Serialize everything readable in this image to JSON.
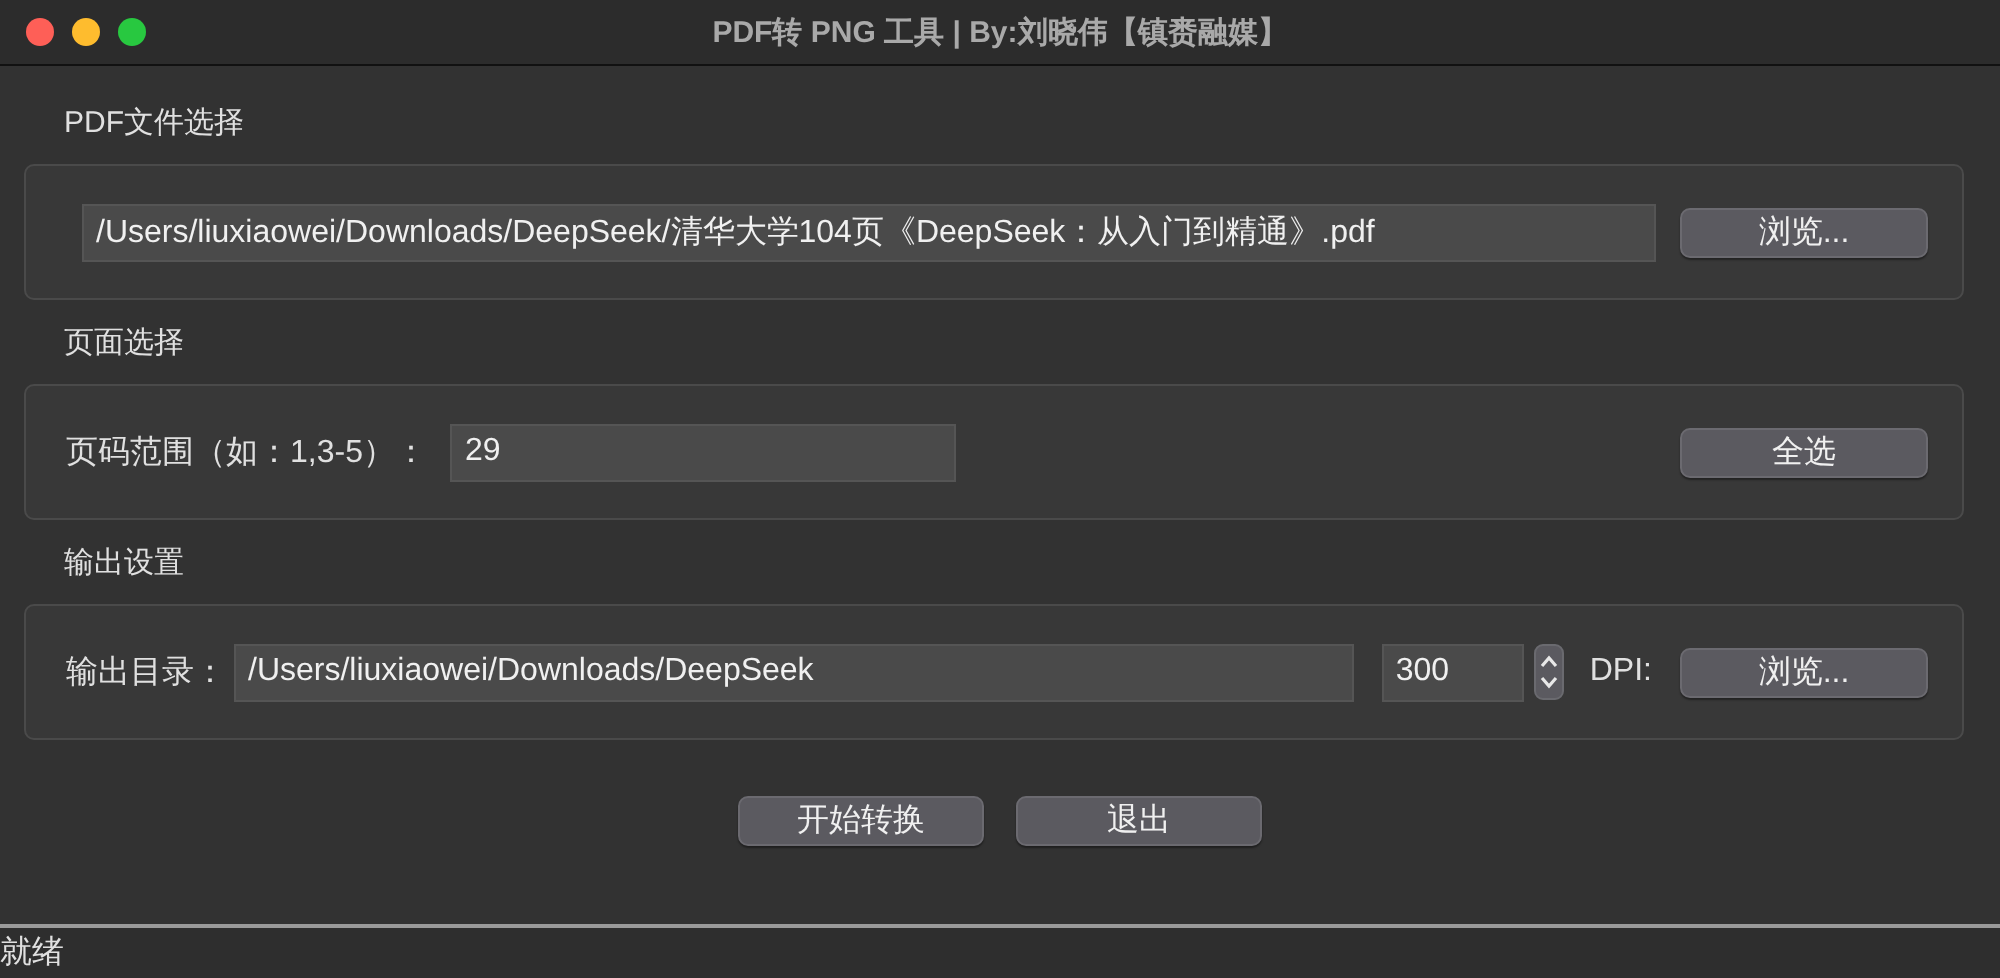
{
  "window": {
    "title": "PDF转 PNG 工具 | By:刘晓伟【镇赉融媒】"
  },
  "sections": [
    {
      "kind": "file",
      "title": "PDF文件选择",
      "items": [
        {
          "kind": "field",
          "value": "/Users/liuxiaowei/Downloads/DeepSeek/清华大学104页《DeepSeek：从入门到精通》.pdf"
        },
        {
          "kind": "button",
          "text": "浏览..."
        }
      ]
    },
    {
      "kind": "pages",
      "title": "页面选择",
      "items": [
        {
          "kind": "label",
          "text": "页码范围（如：1,3-5）："
        },
        {
          "kind": "field",
          "value": "29"
        },
        {
          "kind": "button",
          "text": "全选"
        }
      ]
    },
    {
      "kind": "output",
      "title": "输出设置",
      "items": [
        {
          "kind": "label",
          "text": "输出目录："
        },
        {
          "kind": "field",
          "value": "/Users/liuxiaowei/Downloads/DeepSeek"
        },
        {
          "kind": "spin",
          "value": "300"
        },
        {
          "kind": "label",
          "text": "DPI:"
        },
        {
          "kind": "button",
          "text": "浏览..."
        }
      ]
    }
  ],
  "actions": [
    "开始转换",
    "退出"
  ],
  "status_bar": {
    "text": "就绪"
  }
}
